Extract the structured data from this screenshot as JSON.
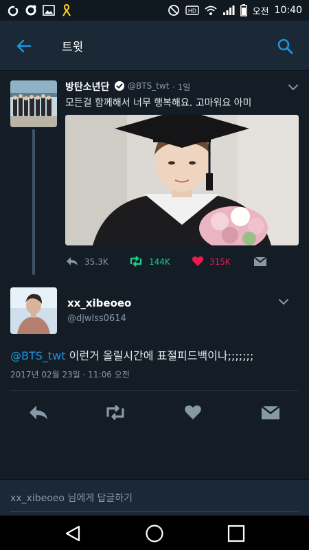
{
  "status_bar": {
    "clock": "10:40",
    "ampm": "오전",
    "left_icons": [
      "cloud-icon",
      "settings-icon",
      "image-icon",
      "ribbon-icon"
    ],
    "right_icons": [
      "do-not-disturb-icon",
      "hd-icon",
      "wifi-icon",
      "signal-icon",
      "battery-icon"
    ]
  },
  "appbar": {
    "title": "트윗",
    "back_icon": "arrow-left-icon",
    "search_icon": "search-icon"
  },
  "quoted_tweet": {
    "name": "방탄소년단",
    "handle": "@BTS_twt",
    "time": "· 1일",
    "text": "모든걸 함께해서 너무 행복해요. 고마워요 아미",
    "replies": "35.3K",
    "retweets": "144K",
    "likes": "315K"
  },
  "main_tweet": {
    "name": "xx_xibeoeo",
    "handle": "@djwlss0614",
    "mention": "@BTS_twt",
    "text": " 이런거 올릴시간에 표절피드백이나;;;;;;;",
    "date": "2017년 02월 23일 · 11:06 오전"
  },
  "reply": {
    "placeholder": "xx_xibeoeo 님에게 답글하기"
  },
  "colors": {
    "background": "#141d26",
    "appbar": "#1b2836",
    "accent": "#1b95e0",
    "retweet_green": "#19cf86",
    "like_pink": "#e81c4f",
    "muted": "#8899a6"
  }
}
